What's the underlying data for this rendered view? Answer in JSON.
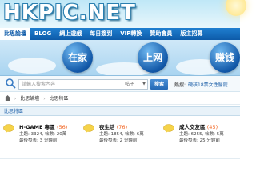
{
  "header": {
    "logo": "HKPIC.NET"
  },
  "nav": {
    "items": [
      "比思論壇",
      "BLOG",
      "網上遊戲",
      "每日簽到",
      "VIP轉換",
      "贊助會員",
      "版主招募"
    ]
  },
  "banner": {
    "bubbles": [
      "在家",
      "上网",
      "赚钱"
    ]
  },
  "search": {
    "placeholder": "請輸入搜索內容",
    "scope": "帖子",
    "button": "搜索",
    "hot_label": "熱搜:",
    "hot_link": "硬核18禁女性醫院"
  },
  "breadcrumb": {
    "items": [
      "比思論壇",
      "比思特區"
    ]
  },
  "section": {
    "title": "比思特區"
  },
  "forums": [
    {
      "name": "H-GAME 專區",
      "count": "(56)",
      "stats": "主題: 3324, 帖數: 20萬",
      "last": "最後發表: 3 分鐘前"
    },
    {
      "name": "夜生活",
      "count": "(76)",
      "stats": "主題: 1854, 帖數: 6萬",
      "last": "最後發表: 2 分鐘前"
    },
    {
      "name": "成人交友區",
      "count": "(45)",
      "stats": "主題: 6255, 帖數: 5萬",
      "last": "最後發表: 25 分鐘前"
    }
  ],
  "colors": {
    "nav": "#0d5aa8",
    "accent": "#f26522",
    "link": "#1c5fa8"
  }
}
